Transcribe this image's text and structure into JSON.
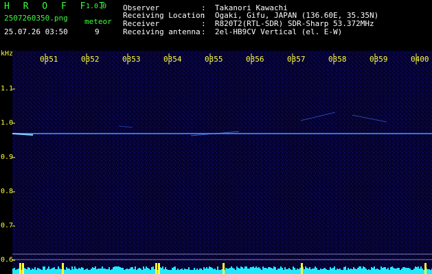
{
  "app": {
    "name": "H R O F F T",
    "version": "1.0.0",
    "filename": "2507260350.png",
    "timestamp": "25.07.26 03:50",
    "meteor_label": "meteor",
    "meteor_count": "9"
  },
  "station": {
    "rows": [
      {
        "label": "Observer",
        "value": ":  Takanori Kawachi"
      },
      {
        "label": "Receiving Location",
        "value": ":  Ogaki, Gifu, JAPAN (136.60E, 35.35N)"
      },
      {
        "label": "Receiver",
        "value": ":  R820T2(RTL-SDR) SDR-Sharp 53.372MHz"
      },
      {
        "label": "Receiving antenna",
        "value": ":  2el-HB9CV Vertical (el. E-W)"
      }
    ]
  },
  "axes": {
    "khz_unit": "kHz",
    "time_ticks": [
      "0351",
      "0352",
      "0353",
      "0354",
      "0355",
      "0356",
      "0357",
      "0358",
      "0359",
      "0400"
    ],
    "khz_ticks": [
      "1.1",
      "1.0",
      "0.9",
      "0.8",
      "0.7",
      "0.6"
    ]
  },
  "colors": {
    "background": "#000000",
    "spectrogram_bg": "#05022e",
    "carrier": "#4f8fff",
    "tick": "#ffff40",
    "header_green": "#39ff3c",
    "level_cyan": "#20e8ff",
    "level_yellow": "#ffff30"
  }
}
